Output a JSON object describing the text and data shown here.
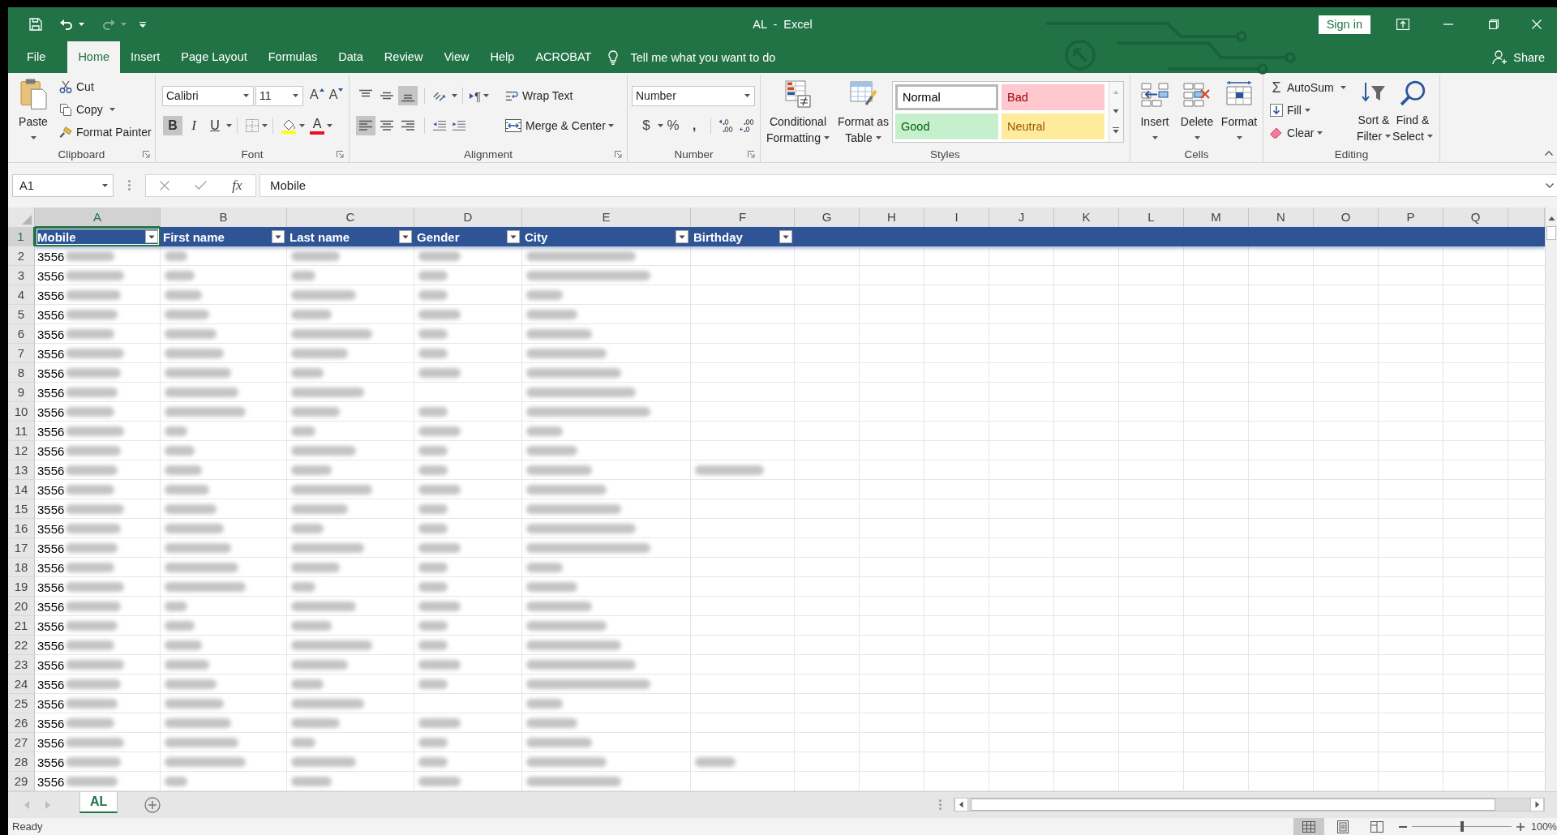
{
  "title_bar": {
    "quick_access": [
      {
        "kind": "save",
        "disabled": false
      },
      {
        "kind": "undo",
        "disabled": false
      },
      {
        "kind": "redo",
        "disabled": true
      }
    ],
    "title": "AL - Excel",
    "sign_in": "Sign in"
  },
  "tabs": [
    {
      "label": "File",
      "selected": false
    },
    {
      "label": "Home",
      "selected": true
    },
    {
      "label": "Insert",
      "selected": false
    },
    {
      "label": "Page Layout",
      "selected": false
    },
    {
      "label": "Formulas",
      "selected": false
    },
    {
      "label": "Data",
      "selected": false
    },
    {
      "label": "Review",
      "selected": false
    },
    {
      "label": "View",
      "selected": false
    },
    {
      "label": "Help",
      "selected": false
    },
    {
      "label": "ACROBAT",
      "selected": false
    }
  ],
  "tell_me": {
    "placeholder": "Tell me what you want to do"
  },
  "share": "Share",
  "clipboard": {
    "label": "Clipboard",
    "launcher": true,
    "paste": "Paste",
    "cut": "Cut",
    "copy": "Copy",
    "format_painter": "Format Painter"
  },
  "font": {
    "label": "Font",
    "launcher": true,
    "name": "Calibri",
    "size": "11",
    "grow": "A",
    "shrink": "A",
    "styles": [
      {
        "kind": "bold",
        "glyph": "B",
        "pressed": true
      },
      {
        "kind": "italic",
        "glyph": "I",
        "pressed": false
      },
      {
        "kind": "underline",
        "glyph": "U",
        "pressed": false
      }
    ],
    "font_color": "A"
  },
  "alignment": {
    "label": "Alignment",
    "launcher": true,
    "vertical": [
      {
        "kind": "top",
        "pressed": false
      },
      {
        "kind": "middle",
        "pressed": false
      },
      {
        "kind": "bottom",
        "pressed": true
      }
    ],
    "horizontal": [
      {
        "kind": "left",
        "pressed": true
      },
      {
        "kind": "center",
        "pressed": false
      },
      {
        "kind": "right",
        "pressed": false
      }
    ],
    "text_direction": "¶",
    "wrap_text": "Wrap Text",
    "merge_center": "Merge & Center"
  },
  "number": {
    "label": "Number",
    "launcher": true,
    "format": "Number",
    "currency": "$",
    "percent": "%",
    "comma": ","
  },
  "styles": {
    "label": "Styles",
    "conditional_formatting": [
      "Conditional",
      "Formatting"
    ],
    "format_as_table": [
      "Format as",
      "Table"
    ],
    "gallery": [
      {
        "label": "Normal",
        "kind": "normal",
        "selected": true
      },
      {
        "label": "Bad",
        "kind": "bad",
        "selected": false
      },
      {
        "label": "Good",
        "kind": "good",
        "selected": false
      },
      {
        "label": "Neutral",
        "kind": "neutral",
        "selected": false
      }
    ]
  },
  "cells": {
    "label": "Cells",
    "buttons": [
      {
        "kind": "insert",
        "label": "Insert"
      },
      {
        "kind": "delete",
        "label": "Delete"
      },
      {
        "kind": "format",
        "label": "Format"
      }
    ]
  },
  "editing": {
    "label": "Editing",
    "autosum_glyph": "Σ",
    "autosum": "AutoSum",
    "fill": "Fill",
    "clear": "Clear",
    "sort_filter": [
      "Sort &",
      "Filter"
    ],
    "find_select": [
      "Find &",
      "Select"
    ]
  },
  "formula_bar": {
    "name_box": "A1",
    "buttons": [
      {
        "kind": "cancel",
        "disabled": true
      },
      {
        "kind": "enter",
        "disabled": true
      }
    ],
    "fx": "fx",
    "value": "Mobile"
  },
  "sheet": {
    "columns": [
      {
        "label": "A",
        "selected": true
      },
      {
        "label": "B",
        "selected": false
      },
      {
        "label": "C",
        "selected": false
      },
      {
        "label": "D",
        "selected": false
      },
      {
        "label": "E",
        "selected": false
      },
      {
        "label": "F",
        "selected": false
      },
      {
        "label": "G",
        "selected": false
      },
      {
        "label": "H",
        "selected": false
      },
      {
        "label": "I",
        "selected": false
      },
      {
        "label": "J",
        "selected": false
      },
      {
        "label": "K",
        "selected": false
      },
      {
        "label": "L",
        "selected": false
      },
      {
        "label": "M",
        "selected": false
      },
      {
        "label": "N",
        "selected": false
      },
      {
        "label": "O",
        "selected": false
      },
      {
        "label": "P",
        "selected": false
      },
      {
        "label": "Q",
        "selected": false
      }
    ],
    "header_row": {
      "number": "1",
      "selected": true,
      "cells": [
        {
          "text": "Mobile",
          "filter": true,
          "selected": true
        },
        {
          "text": "First name",
          "filter": true,
          "selected": false
        },
        {
          "text": "Last name",
          "filter": true,
          "selected": false
        },
        {
          "text": "Gender",
          "filter": true,
          "selected": false
        },
        {
          "text": "City",
          "filter": true,
          "selected": false
        },
        {
          "text": "Birthday",
          "filter": true,
          "selected": false
        }
      ]
    },
    "rows": [
      {
        "number": "2",
        "selected": false,
        "cells": [
          {
            "text": "3556",
            "blurred": true
          },
          {
            "blurred": true
          },
          {
            "blurred": true
          },
          {
            "blurred": true
          },
          {
            "blurred": true
          },
          {
            "blurred": false
          }
        ]
      },
      {
        "number": "3",
        "selected": false,
        "cells": [
          {
            "text": "3556",
            "blurred": true
          },
          {
            "blurred": true
          },
          {
            "blurred": true
          },
          {
            "blurred": true
          },
          {
            "blurred": true
          },
          {
            "blurred": false
          }
        ]
      },
      {
        "number": "4",
        "selected": false,
        "cells": [
          {
            "text": "3556",
            "blurred": true
          },
          {
            "blurred": true
          },
          {
            "blurred": true
          },
          {
            "blurred": true
          },
          {
            "blurred": true
          },
          {
            "blurred": false
          }
        ]
      },
      {
        "number": "5",
        "selected": false,
        "cells": [
          {
            "text": "3556",
            "blurred": true
          },
          {
            "blurred": true
          },
          {
            "blurred": true
          },
          {
            "blurred": true
          },
          {
            "blurred": true
          },
          {
            "blurred": false
          }
        ]
      },
      {
        "number": "6",
        "selected": false,
        "cells": [
          {
            "text": "3556",
            "blurred": true
          },
          {
            "blurred": true
          },
          {
            "blurred": true
          },
          {
            "blurred": true
          },
          {
            "blurred": true
          },
          {
            "blurred": false
          }
        ]
      },
      {
        "number": "7",
        "selected": false,
        "cells": [
          {
            "text": "3556",
            "blurred": true
          },
          {
            "blurred": true
          },
          {
            "blurred": true
          },
          {
            "blurred": true
          },
          {
            "blurred": true
          },
          {
            "blurred": false
          }
        ]
      },
      {
        "number": "8",
        "selected": false,
        "cells": [
          {
            "text": "3556",
            "blurred": true
          },
          {
            "blurred": true
          },
          {
            "blurred": true
          },
          {
            "blurred": true
          },
          {
            "blurred": true
          },
          {
            "blurred": false
          }
        ]
      },
      {
        "number": "9",
        "selected": false,
        "cells": [
          {
            "text": "3556",
            "blurred": true
          },
          {
            "blurred": true
          },
          {
            "blurred": true
          },
          {
            "blurred": false
          },
          {
            "blurred": true
          },
          {
            "blurred": false
          }
        ]
      },
      {
        "number": "10",
        "selected": false,
        "cells": [
          {
            "text": "3556",
            "blurred": true
          },
          {
            "blurred": true
          },
          {
            "blurred": true
          },
          {
            "blurred": true
          },
          {
            "blurred": true
          },
          {
            "blurred": false
          }
        ]
      },
      {
        "number": "11",
        "selected": false,
        "cells": [
          {
            "text": "3556",
            "blurred": true
          },
          {
            "blurred": true
          },
          {
            "blurred": true
          },
          {
            "blurred": true
          },
          {
            "blurred": true
          },
          {
            "blurred": false
          }
        ]
      },
      {
        "number": "12",
        "selected": false,
        "cells": [
          {
            "text": "3556",
            "blurred": true
          },
          {
            "blurred": true
          },
          {
            "blurred": true
          },
          {
            "blurred": true
          },
          {
            "blurred": true
          },
          {
            "blurred": false
          }
        ]
      },
      {
        "number": "13",
        "selected": false,
        "cells": [
          {
            "text": "3556",
            "blurred": true
          },
          {
            "blurred": true
          },
          {
            "blurred": true
          },
          {
            "blurred": true
          },
          {
            "blurred": true
          },
          {
            "blurred": true
          }
        ]
      },
      {
        "number": "14",
        "selected": false,
        "cells": [
          {
            "text": "3556",
            "blurred": true
          },
          {
            "blurred": true
          },
          {
            "blurred": true
          },
          {
            "blurred": true
          },
          {
            "blurred": true
          },
          {
            "blurred": false
          }
        ]
      },
      {
        "number": "15",
        "selected": false,
        "cells": [
          {
            "text": "3556",
            "blurred": true
          },
          {
            "blurred": true
          },
          {
            "blurred": true
          },
          {
            "blurred": true
          },
          {
            "blurred": true
          },
          {
            "blurred": false
          }
        ]
      },
      {
        "number": "16",
        "selected": false,
        "cells": [
          {
            "text": "3556",
            "blurred": true
          },
          {
            "blurred": true
          },
          {
            "blurred": true
          },
          {
            "blurred": true
          },
          {
            "blurred": true
          },
          {
            "blurred": false
          }
        ]
      },
      {
        "number": "17",
        "selected": false,
        "cells": [
          {
            "text": "3556",
            "blurred": true
          },
          {
            "blurred": true
          },
          {
            "blurred": true
          },
          {
            "blurred": true
          },
          {
            "blurred": true
          },
          {
            "blurred": false
          }
        ]
      },
      {
        "number": "18",
        "selected": false,
        "cells": [
          {
            "text": "3556",
            "blurred": true
          },
          {
            "blurred": true
          },
          {
            "blurred": true
          },
          {
            "blurred": true
          },
          {
            "blurred": true
          },
          {
            "blurred": false
          }
        ]
      },
      {
        "number": "19",
        "selected": false,
        "cells": [
          {
            "text": "3556",
            "blurred": true
          },
          {
            "blurred": true
          },
          {
            "blurred": true
          },
          {
            "blurred": true
          },
          {
            "blurred": true
          },
          {
            "blurred": false
          }
        ]
      },
      {
        "number": "20",
        "selected": false,
        "cells": [
          {
            "text": "3556",
            "blurred": true
          },
          {
            "blurred": true
          },
          {
            "blurred": true
          },
          {
            "blurred": true
          },
          {
            "blurred": true
          },
          {
            "blurred": false
          }
        ]
      },
      {
        "number": "21",
        "selected": false,
        "cells": [
          {
            "text": "3556",
            "blurred": true
          },
          {
            "blurred": true
          },
          {
            "blurred": true
          },
          {
            "blurred": true
          },
          {
            "blurred": true
          },
          {
            "blurred": false
          }
        ]
      },
      {
        "number": "22",
        "selected": false,
        "cells": [
          {
            "text": "3556",
            "blurred": true
          },
          {
            "blurred": true
          },
          {
            "blurred": true
          },
          {
            "blurred": true
          },
          {
            "blurred": true
          },
          {
            "blurred": false
          }
        ]
      },
      {
        "number": "23",
        "selected": false,
        "cells": [
          {
            "text": "3556",
            "blurred": true
          },
          {
            "blurred": true
          },
          {
            "blurred": true
          },
          {
            "blurred": true
          },
          {
            "blurred": true
          },
          {
            "blurred": false
          }
        ]
      },
      {
        "number": "24",
        "selected": false,
        "cells": [
          {
            "text": "3556",
            "blurred": true
          },
          {
            "blurred": true
          },
          {
            "blurred": true
          },
          {
            "blurred": true
          },
          {
            "blurred": true
          },
          {
            "blurred": false
          }
        ]
      },
      {
        "number": "25",
        "selected": false,
        "cells": [
          {
            "text": "3556",
            "blurred": true
          },
          {
            "blurred": true
          },
          {
            "blurred": true
          },
          {
            "blurred": false
          },
          {
            "blurred": true
          },
          {
            "blurred": false
          }
        ]
      },
      {
        "number": "26",
        "selected": false,
        "cells": [
          {
            "text": "3556",
            "blurred": true
          },
          {
            "blurred": true
          },
          {
            "blurred": true
          },
          {
            "blurred": true
          },
          {
            "blurred": true
          },
          {
            "blurred": false
          }
        ]
      },
      {
        "number": "27",
        "selected": false,
        "cells": [
          {
            "text": "3556",
            "blurred": true
          },
          {
            "blurred": true
          },
          {
            "blurred": true
          },
          {
            "blurred": true
          },
          {
            "blurred": true
          },
          {
            "blurred": false
          }
        ]
      },
      {
        "number": "28",
        "selected": false,
        "cells": [
          {
            "text": "3556",
            "blurred": true
          },
          {
            "blurred": true
          },
          {
            "blurred": true
          },
          {
            "blurred": true
          },
          {
            "blurred": true
          },
          {
            "blurred": true
          }
        ]
      },
      {
        "number": "29",
        "selected": false,
        "cells": [
          {
            "text": "3556",
            "blurred": true
          },
          {
            "blurred": true
          },
          {
            "blurred": true
          },
          {
            "blurred": true
          },
          {
            "blurred": true
          },
          {
            "blurred": false
          }
        ]
      }
    ]
  },
  "sheet_nav": [
    {
      "kind": "previous",
      "disabled": true
    },
    {
      "kind": "next",
      "disabled": true
    }
  ],
  "sheet_tabs": [
    {
      "label": "AL",
      "selected": true
    }
  ],
  "status_bar": {
    "status": "Ready",
    "views": [
      {
        "kind": "normal",
        "selected": true
      },
      {
        "kind": "page_layout",
        "selected": false
      },
      {
        "kind": "page_break",
        "selected": false
      }
    ],
    "zoom": {
      "level": 0.5
    },
    "zoom_label": "100%"
  }
}
